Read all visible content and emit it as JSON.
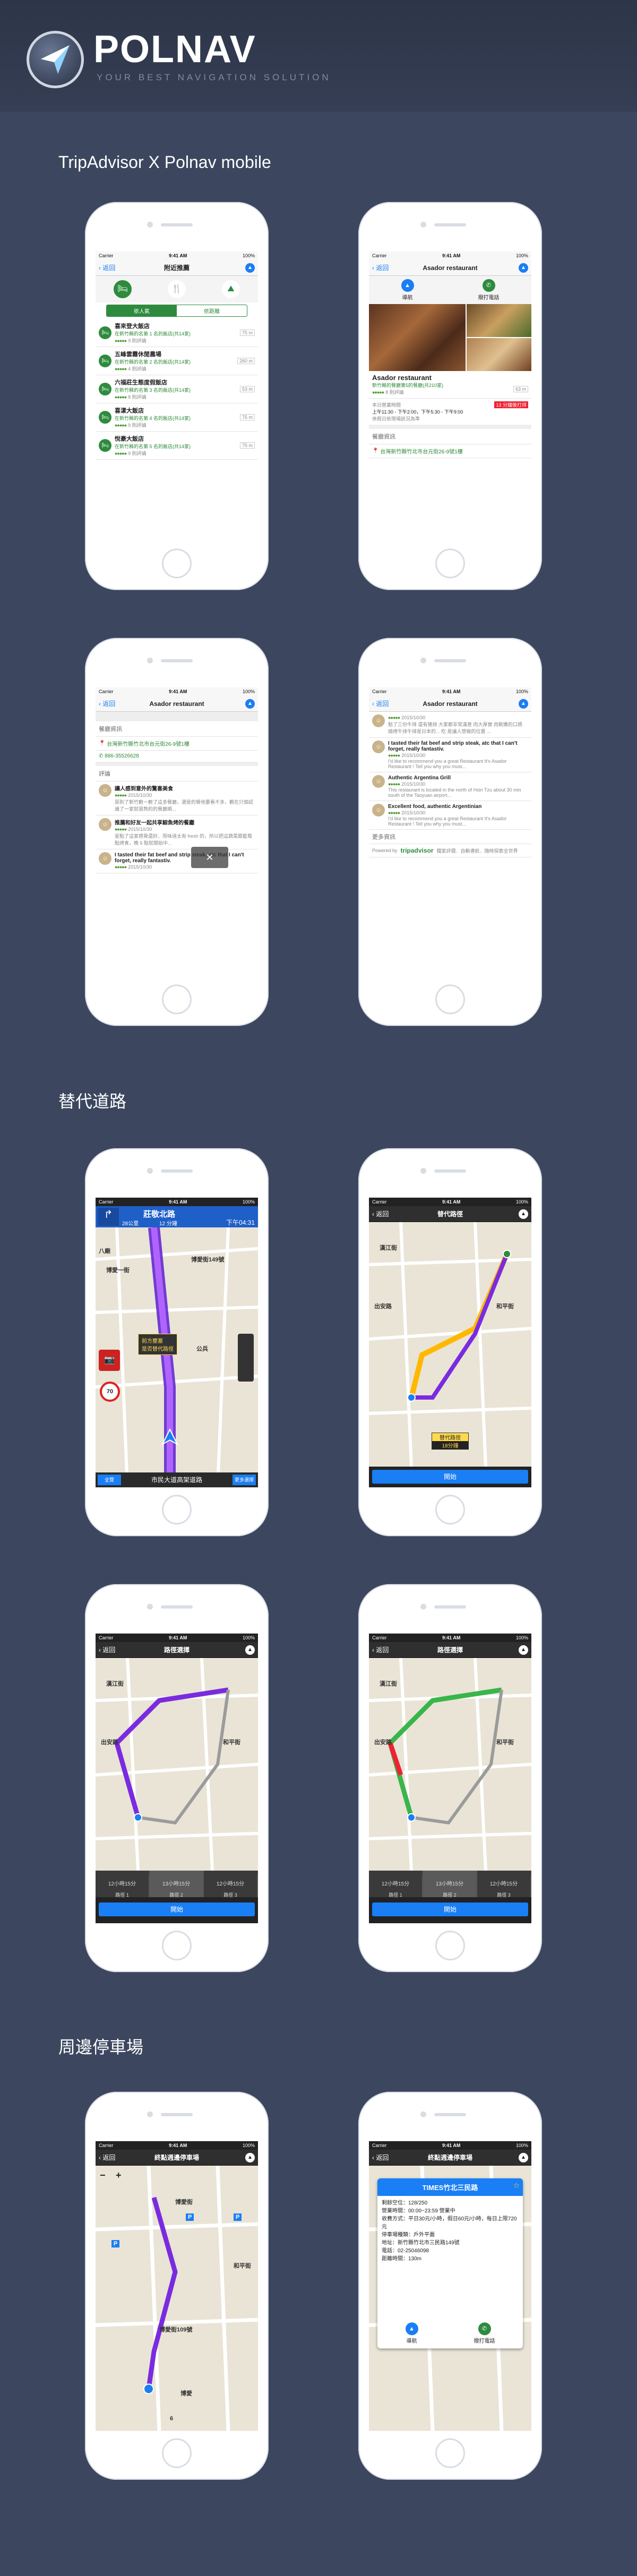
{
  "brand": {
    "name": "POLNAV",
    "tagline": "YOUR BEST NAVIGATION SOLUTION"
  },
  "sections": {
    "s1": "TripAdvisor X Polnav mobile",
    "s2": "替代道路",
    "s3": "周邊停車場"
  },
  "status": {
    "carrier": "Carrier",
    "time": "9:41 AM",
    "battery": "100%"
  },
  "nav": {
    "back": "返回",
    "nearby": "附近推薦",
    "restaurant": "Asador restaurant",
    "alt": "替代路徑",
    "route": "路徑選擇",
    "parking": "終點週邊停車場"
  },
  "p1": {
    "tabs": [
      "依人氣",
      "依距離"
    ],
    "items": [
      {
        "name": "喜來登大飯店",
        "sub": "在新竹縣的名第 1 名的飯店(共14家)",
        "dist": "75 m",
        "reviews": "9 則評論"
      },
      {
        "name": "五峰雲霧休閒農場",
        "sub": "在新竹縣的名第 2 名的飯店(共14家)",
        "dist": "260 m",
        "reviews": "4 則評論"
      },
      {
        "name": "六福莊生態度假飯店",
        "sub": "在新竹縣的名第 3 名的飯店(共14家)",
        "dist": "53 m",
        "reviews": "8 則評論"
      },
      {
        "name": "喜漾大飯店",
        "sub": "在新竹縣的名第 4 名的飯店(共14家)",
        "dist": "75 m",
        "reviews": "9 則評論"
      },
      {
        "name": "悅豪大飯店",
        "sub": "在新竹縣的名第 5 名的飯店(共14家)",
        "dist": "75 m",
        "reviews": "9 則評論"
      }
    ]
  },
  "p2": {
    "nav_label": "導航",
    "call_label": "撥打電話",
    "title": "Asador restaurant",
    "rank": "新竹縣的餐廳第5的餐廳(共210家)",
    "dist": "63 m",
    "reviews": "8 則評論",
    "open_label": "本日營業時間",
    "closed": "13 分鐘後打烊",
    "hours": "上午11:30 - 下午2:00，下午5:30 - 下午9:00",
    "holiday": "休假日依現場狀況為準",
    "info_head": "餐廳資訊",
    "address": "台灣新竹縣竹北市台元街26-9號1樓"
  },
  "p3": {
    "info_head": "餐廳資訊",
    "address": "台灣新竹縣竹北市台元街26-9號1樓",
    "phone": "886-35526628",
    "review_head": "評論",
    "reviews": [
      {
        "title": "讓人感到意外的驚喜美食",
        "date": "2015/10/30",
        "text": "原則了新竹數一數了這多餐廳，選是的餐他要看不多，觀在只個認識了一家就很熟的的餐廳順..."
      },
      {
        "title": "推薦和好友一起共享鯨魚烤的餐廳",
        "date": "2015/10/30",
        "text": "星點了這家感覺還好、而味道太有 fresh 的，所以把這蔬菜跟藍莓點烤食，晚 6 點就開始中..."
      },
      {
        "title": "I tasted their fat beef and strip steak, atc that I can't forget, really fantastiv.",
        "date": "2015/10/30",
        "text": ""
      }
    ]
  },
  "p4": {
    "items": [
      {
        "title": "",
        "date": "2015/10/30",
        "text": "點了三份牛排 還有猪排 大家都非常滿意 肉大厚實 肉軟嫩的口感 燒烤牛排牛排是日本的... 吃 是讓人想做的位置 ..."
      },
      {
        "title": "I tasted their fat beef and strip steak, atc that I can't forget, really fantastiv.",
        "date": "2015/10/30",
        "text": "I'd like to recommend you a great Restaurant It's Asador Restaurant ! Tell you why you must..."
      },
      {
        "title": "Authentic Argentina Grill",
        "date": "2015/10/30",
        "text": "This restaurant is located in the north of Hsin Tzu about 30 min south of the Taoyuan airport..."
      },
      {
        "title": "Excellent food, authentic Argentinian",
        "date": "2015/10/30",
        "text": "I'd like to recommend you a great Restaurant It's Asador Restaurant ! Tell you why you must..."
      }
    ],
    "more": "更多資訊",
    "powered": "Powered by",
    "ta": "tripadvisor",
    "ta_note": "獨家評價．自動導航．隨時探索全世界"
  },
  "p5": {
    "dist": "28公里",
    "turn_dist": "12 分鐘",
    "road": "莊敬北路",
    "eta": "下午04:31",
    "speed": "70",
    "alt_tip": "前方壅塞",
    "alt_tip2": "是否替代路徑",
    "b1": "博愛一街",
    "b2": "博愛街149號",
    "b3": "八廟",
    "b4": "公兵",
    "bottom": "市民大道高架道路",
    "btn_l": "全覽",
    "btn_r": "更多選擇"
  },
  "p6": {
    "badge": "替代路徑",
    "time": "18分鐘",
    "start": "開始",
    "l1": "漢江街",
    "l2": "和平街",
    "l3": "出安路"
  },
  "p7": {
    "routes": [
      {
        "l": "12小時15分",
        "s": "路徑 1"
      },
      {
        "l": "13小時15分",
        "s": "路徑 2"
      },
      {
        "l": "12小時15分",
        "s": "路徑 3"
      }
    ],
    "start": "開始",
    "l1": "漢江街",
    "l2": "和平街",
    "l3": "出安路"
  },
  "p8": {
    "routes": [
      {
        "l": "12小時15分",
        "s": "路徑 1"
      },
      {
        "l": "13小時15分",
        "s": "路徑 2"
      },
      {
        "l": "12小時15分",
        "s": "路徑 3"
      }
    ],
    "start": "開始",
    "l1": "漢江街",
    "l2": "和平街",
    "l3": "出安路"
  },
  "p9": {
    "l1": "博愛街",
    "l2": "和平街",
    "l3": "博愛街109號",
    "l4": "博愛",
    "l5": "6"
  },
  "p10": {
    "title": "TIMES竹北三民路",
    "fields": [
      "剩餘空位：128/250",
      "營業時間：00:00~23:59 營業中",
      "收費方式：平日30元/小時，假日60元/小時，每日上限720元",
      "停車場種類：戶外平面",
      "地址：新竹縣竹北市三民路149號",
      "電話：02-25046098",
      "距離時間：130m"
    ],
    "nav_label": "導航",
    "call_label": "撥打電話"
  }
}
